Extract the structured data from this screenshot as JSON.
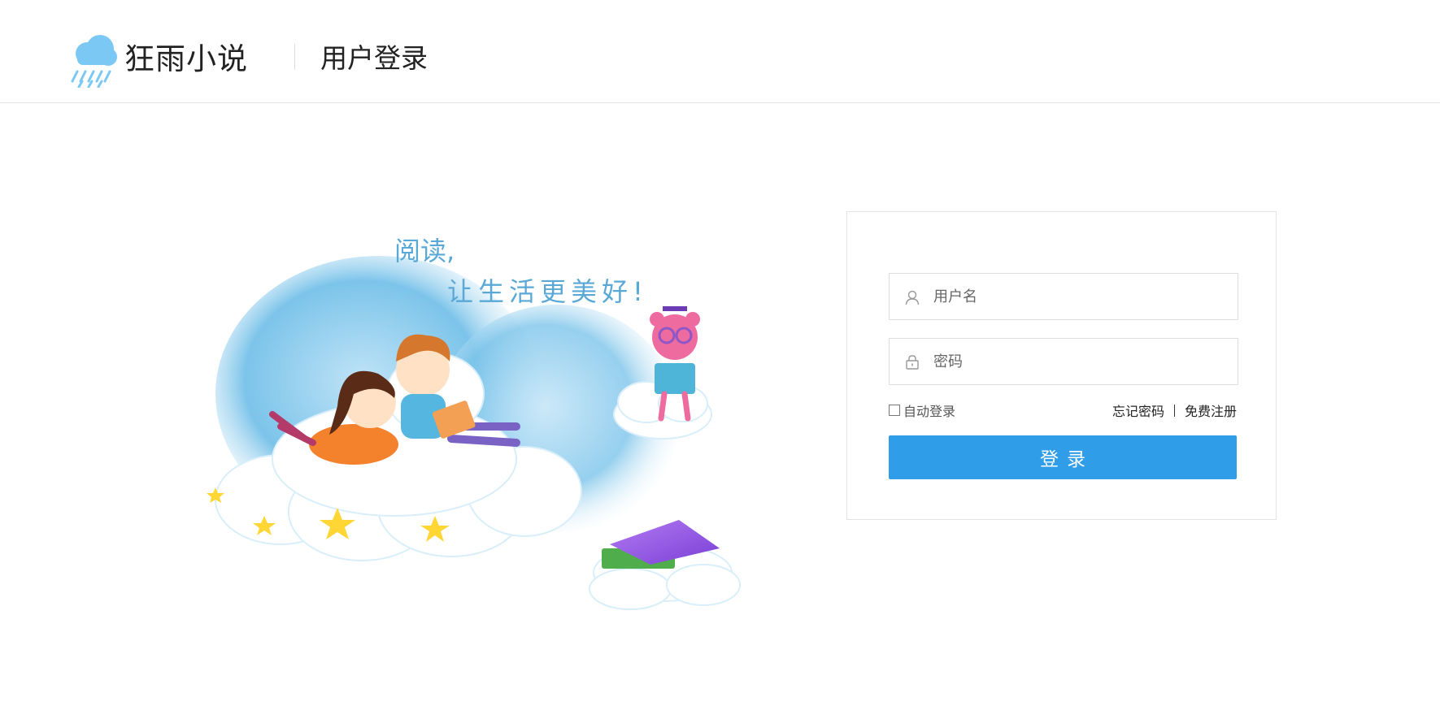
{
  "header": {
    "brand": "狂雨小说",
    "subtitle": "用户登录",
    "logo_icon": "rain-cloud-icon",
    "logo_color": "#7cc8f5"
  },
  "illustration": {
    "slogan_line1": "阅读,",
    "slogan_line2": "让生活更美好!",
    "description_icon": "kids-reading-on-clouds"
  },
  "login": {
    "username_placeholder": "用户名",
    "password_placeholder": "密码",
    "remember_label": "自动登录",
    "forgot_label": "忘记密码",
    "register_label": "免费注册",
    "submit_label": "登录",
    "button_color": "#2f9de8",
    "username_icon": "user-icon",
    "password_icon": "lock-icon"
  }
}
